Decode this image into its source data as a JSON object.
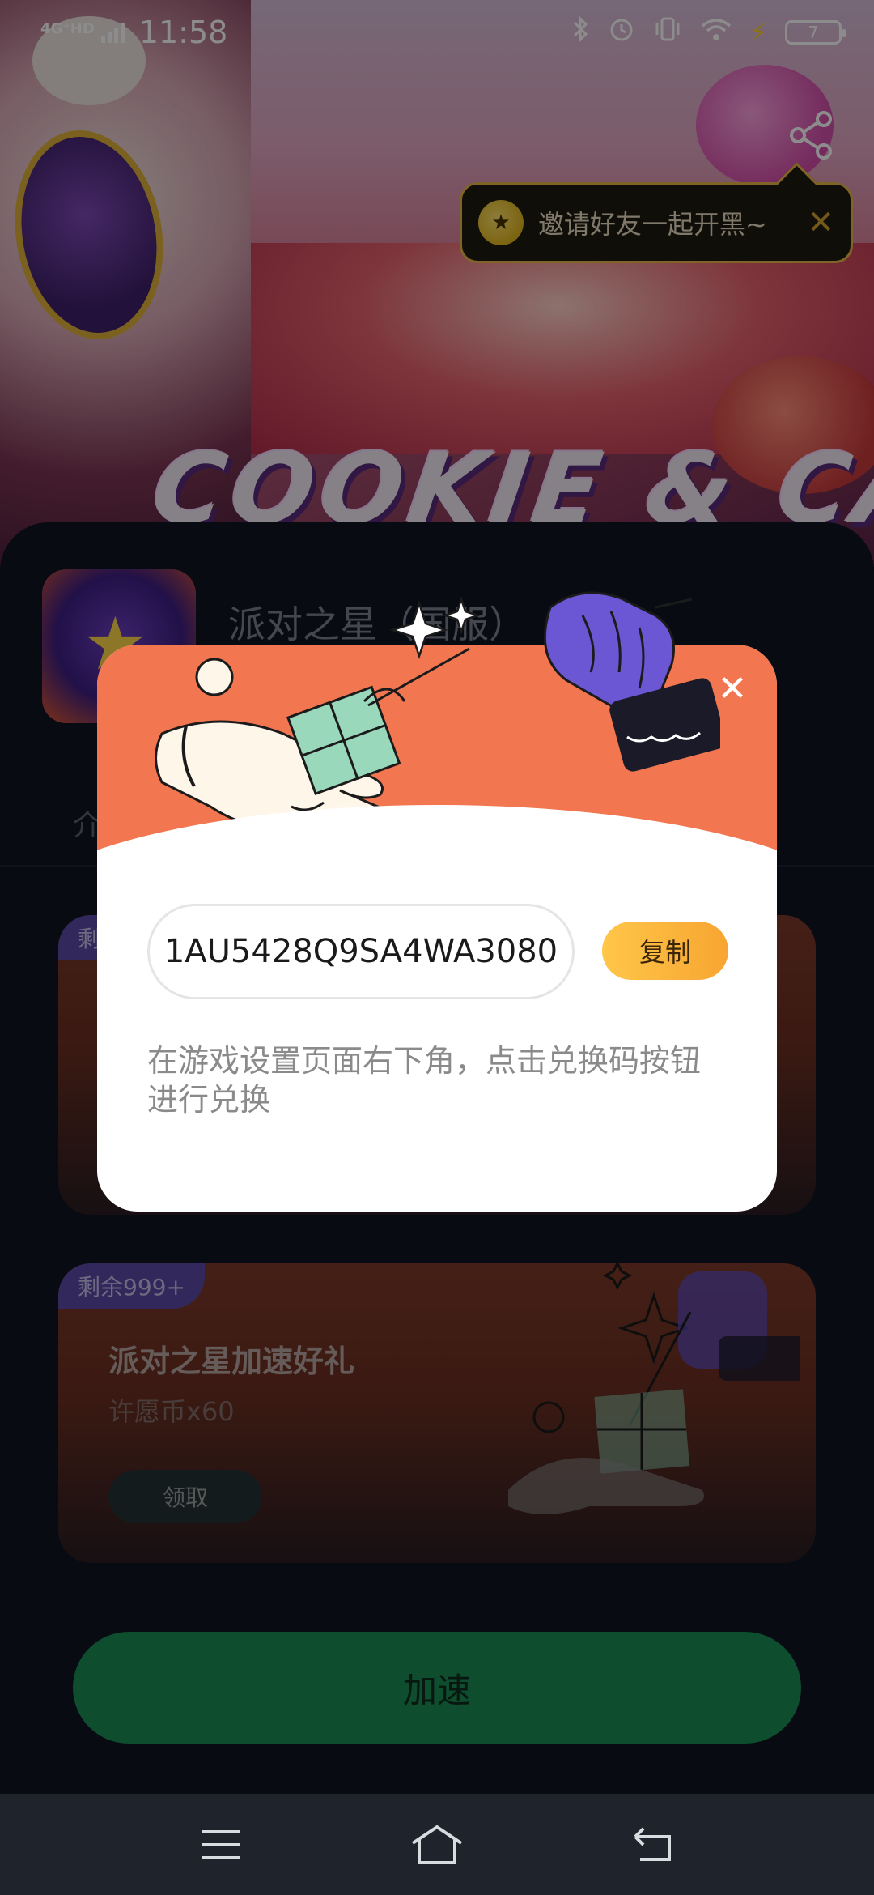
{
  "status_bar": {
    "network": "4G⁺HD",
    "time": "11:58",
    "battery": "7"
  },
  "hero": {
    "banner_text": "COOKIE & CA"
  },
  "invite_tip": {
    "text": "邀请好友一起开黑~",
    "close": "✕"
  },
  "app": {
    "title": "派对之星（国服）",
    "tab_hint": "介"
  },
  "cards": [
    {
      "badge": "剩",
      "title": "",
      "subtitle": "",
      "button": ""
    },
    {
      "badge": "剩余999+",
      "title": "派对之星加速好礼",
      "subtitle": "许愿币x60",
      "button": "领取"
    }
  ],
  "modal": {
    "close": "✕",
    "code": "1AU5428Q9SA4WA3080",
    "copy_label": "复制",
    "description": "在游戏设置页面右下角，点击兑换码按钮进行兑换"
  },
  "primary_action": {
    "label": "加速"
  },
  "nav": {
    "items": [
      "menu-icon",
      "home-icon",
      "back-icon"
    ]
  },
  "colors": {
    "accent_orange": "#f2764f",
    "copy_button": "#f7a531",
    "accelerate_button": "#1b8c55",
    "badge_purple": "#5c4aa8"
  }
}
